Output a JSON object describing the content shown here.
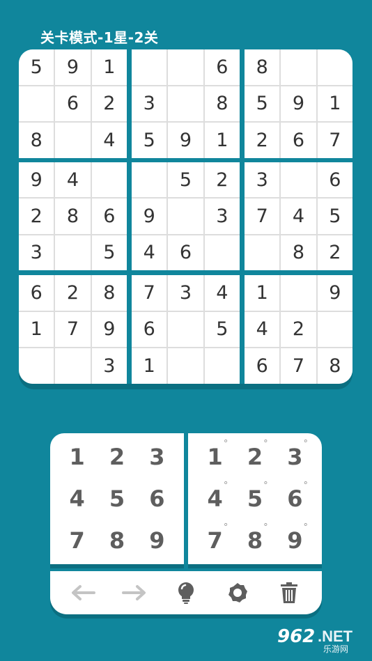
{
  "title": "关卡模式-1星-2关",
  "colors": {
    "background": "#10869c",
    "cell": "#ffffff",
    "digit": "#333333",
    "key": "#5e5e5e"
  },
  "grid": [
    [
      "5",
      "9",
      "1",
      "",
      "",
      "6",
      "8",
      "",
      ""
    ],
    [
      "",
      "6",
      "2",
      "3",
      "",
      "8",
      "5",
      "9",
      "1"
    ],
    [
      "8",
      "",
      "4",
      "5",
      "9",
      "1",
      "2",
      "6",
      "7"
    ],
    [
      "9",
      "4",
      "",
      "",
      "5",
      "2",
      "3",
      "",
      "6"
    ],
    [
      "2",
      "8",
      "6",
      "9",
      "",
      "3",
      "7",
      "4",
      "5"
    ],
    [
      "3",
      "",
      "5",
      "4",
      "6",
      "",
      "",
      "8",
      "2"
    ],
    [
      "6",
      "2",
      "8",
      "7",
      "3",
      "4",
      "1",
      "",
      "9"
    ],
    [
      "1",
      "7",
      "9",
      "6",
      "",
      "5",
      "4",
      "2",
      ""
    ],
    [
      "",
      "",
      "3",
      "1",
      "",
      "",
      "6",
      "7",
      "8"
    ]
  ],
  "keypad": {
    "numbers": [
      "1",
      "2",
      "3",
      "4",
      "5",
      "6",
      "7",
      "8",
      "9"
    ],
    "notes": [
      "1",
      "2",
      "3",
      "4",
      "5",
      "6",
      "7",
      "8",
      "9"
    ],
    "note_mark": "°"
  },
  "toolbar": {
    "undo_icon": "arrow-left-icon",
    "redo_icon": "arrow-right-icon",
    "hint_icon": "lightbulb-icon",
    "settings_icon": "gear-icon",
    "delete_icon": "trash-icon"
  },
  "watermark": {
    "number": "962",
    "suffix": ".NET",
    "subtitle": "乐游网"
  }
}
